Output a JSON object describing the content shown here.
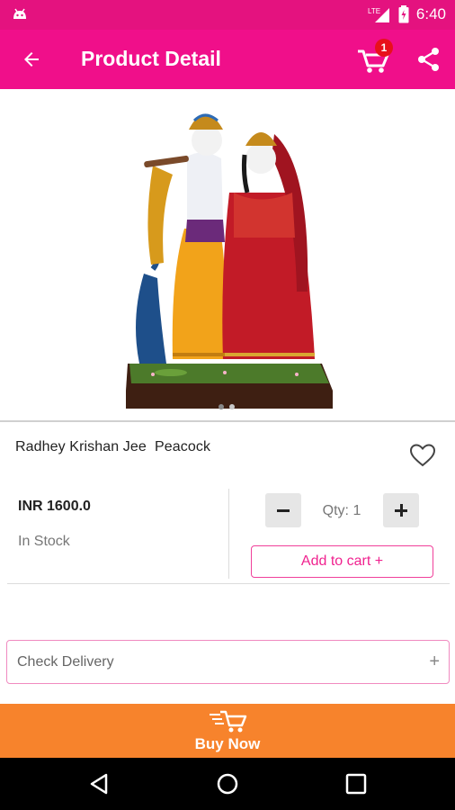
{
  "status_bar": {
    "time": "6:40",
    "network": "LTE",
    "battery_level": 0.8
  },
  "app_bar": {
    "title": "Product Detail",
    "cart_count": "1",
    "colors": {
      "background": "#f00f8a",
      "status": "#e4127f"
    }
  },
  "product": {
    "image_icon": "radha-krishna-figurine-image",
    "gallery_dots": 2,
    "gallery_active": 0,
    "name": "Radhey Krishan Jee  Peacock",
    "price": "INR 1600.0",
    "stock": "In Stock",
    "quantity_label": "Qty: 1",
    "add_to_cart_label": "Add to cart +"
  },
  "delivery": {
    "label": "Check Delivery",
    "expand_symbol": "+"
  },
  "buy_now": {
    "label": "Buy Now",
    "color": "#f7832c"
  }
}
